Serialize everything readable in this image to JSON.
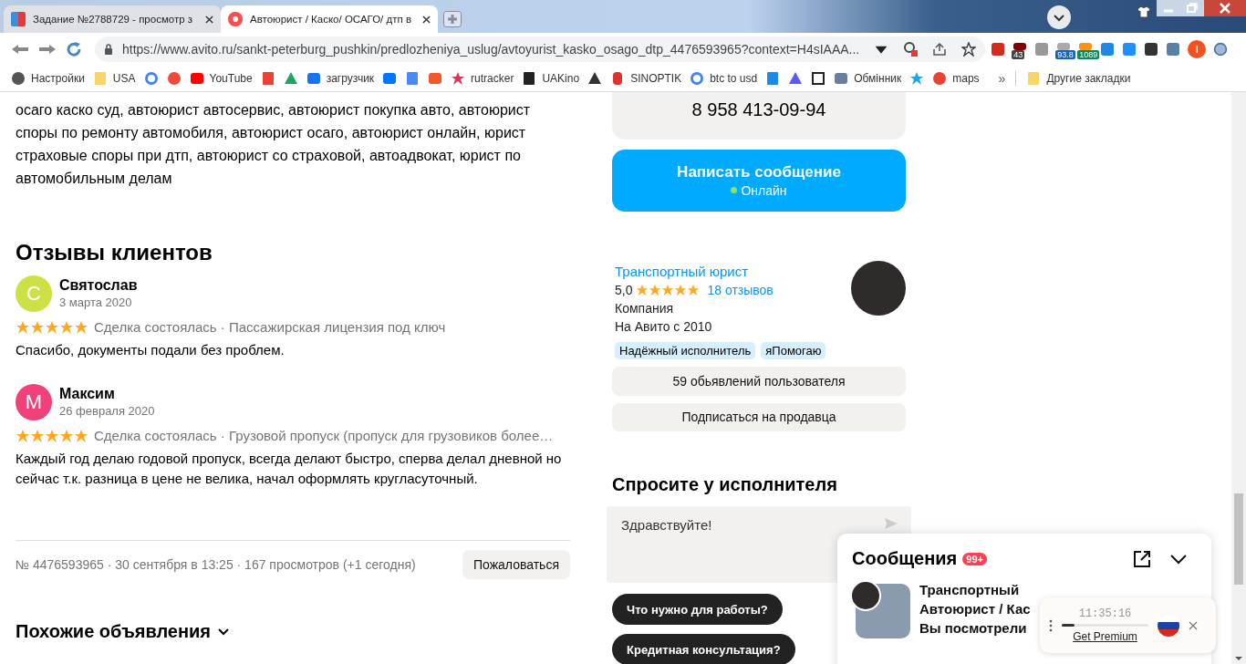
{
  "browser": {
    "tabs": [
      {
        "title": "Задание №2788729 - просмотр з",
        "selected": false
      },
      {
        "title": "Автоюрист / Каско/ ОСАГО/ дтп в",
        "selected": true
      }
    ],
    "url": "https://www.avito.ru/sankt-peterburg_pushkin/predlozheniya_uslug/avtoyurist_kasko_osago_dtp_4476593965?context=H4sIAAA...",
    "extension_badges": [
      "43",
      "93.8",
      "1089"
    ],
    "profile_initial": "I",
    "bookmarks": [
      "Настройки",
      "USA",
      "YouTube",
      "загрузчик",
      "rutracker",
      "UAKino",
      "SINOPTIK",
      "btc to usd",
      "Обмінник",
      "maps"
    ],
    "more": "»",
    "other_bookmarks": "Другие закладки"
  },
  "description": "осаго каско суд, автоюрист автосервис, автоюрист покупка авто, автоюрист споры по ремонту автомобиля, автоюрист осаго, автоюрист онлайн, юрист страховые споры при дтп, автоюрист со страховой, автоадвокат, юрист по автомобильным делам",
  "reviews": {
    "title": "Отзывы клиентов",
    "items": [
      {
        "initial": "С",
        "color": "#cde044",
        "name": "Святослав",
        "date": "3 марта 2020",
        "stars": 5,
        "deal": "Сделка состоялась · Пассажирская лицензия под ключ",
        "text": "Спасибо, документы подали без проблем."
      },
      {
        "initial": "М",
        "color": "#f0417a",
        "name": "Максим",
        "date": "26 февраля 2020",
        "stars": 5,
        "deal": "Сделка состоялась · Грузовой пропуск (пропуск для грузовиков более…",
        "text": "Каждый год делаю годовой пропуск, всегда делают быстро, сперва делал дневной но сейчас т.к. разница в цене не велика, начал оформлять кругласуточный."
      }
    ]
  },
  "listing_meta": "№ 4476593965 · 30 сентября в 13:25 · 167 просмотров (+1 сегодня)",
  "report_button": "Пожаловаться",
  "similar_title": "Похожие объявления",
  "contact": {
    "phone": "8 958 413-09-94",
    "message_button": "Написать сообщение",
    "status": "Онлайн"
  },
  "seller": {
    "name": "Транспортный юрист",
    "rating": "5,0",
    "stars": 5,
    "reviews_link": "18 отзывов",
    "type": "Компания",
    "since": "На Авито с 2010",
    "badges": [
      "Надёжный исполнитель",
      "яПомогаю"
    ],
    "buttons": [
      "59 обьявлений пользователя",
      "Подписаться на продавца"
    ]
  },
  "ask": {
    "title": "Спросите у исполнителя",
    "value": "Здравствуйте!",
    "suggestions": [
      "Что нужно для работы?",
      "Кредитная консультация?"
    ]
  },
  "messages_panel": {
    "title": "Сообщения",
    "badge": "99+",
    "chat_lines": [
      "Транспортный",
      "Автоюрист / Кас",
      "Вы посмотрели"
    ]
  },
  "timer_widget": {
    "time": "11:35:16",
    "level": 0.15,
    "link": "Get Premium"
  }
}
